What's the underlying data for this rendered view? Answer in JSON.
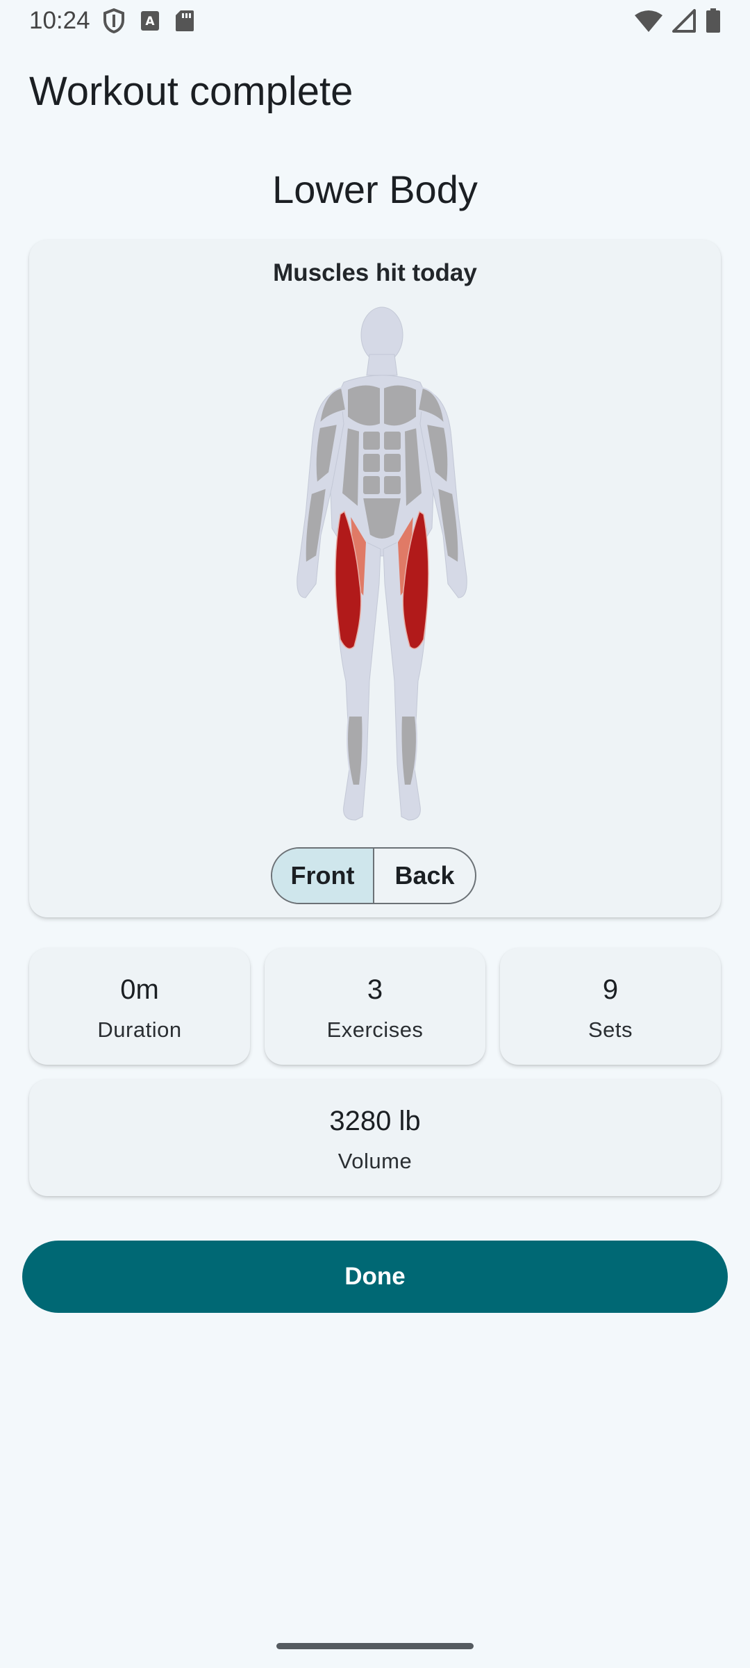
{
  "status_bar": {
    "time": "10:24"
  },
  "header": {
    "title": "Workout complete"
  },
  "workout": {
    "name": "Lower Body"
  },
  "muscle_card": {
    "title": "Muscles hit today",
    "toggle": {
      "front_label": "Front",
      "back_label": "Back",
      "selected": "Front"
    },
    "highlight_colors": {
      "primary": "#b11a1a",
      "secondary": "#e07a66",
      "inactive": "#a9a9ab",
      "body": "#d5d9e6"
    }
  },
  "stats": {
    "duration": {
      "value": "0m",
      "label": "Duration"
    },
    "exercises": {
      "value": "3",
      "label": "Exercises"
    },
    "sets": {
      "value": "9",
      "label": "Sets"
    },
    "volume": {
      "value": "3280 lb",
      "label": "Volume"
    }
  },
  "actions": {
    "done_label": "Done",
    "accent": "#006874"
  }
}
